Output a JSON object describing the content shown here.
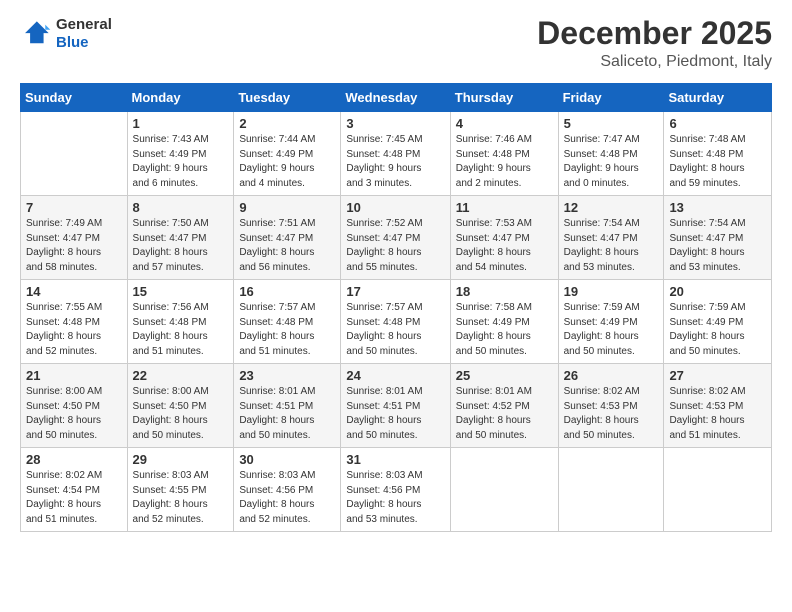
{
  "logo": {
    "line1": "General",
    "line2": "Blue"
  },
  "header": {
    "month": "December 2025",
    "location": "Saliceto, Piedmont, Italy"
  },
  "days_of_week": [
    "Sunday",
    "Monday",
    "Tuesday",
    "Wednesday",
    "Thursday",
    "Friday",
    "Saturday"
  ],
  "weeks": [
    [
      {
        "day": "",
        "info": ""
      },
      {
        "day": "1",
        "info": "Sunrise: 7:43 AM\nSunset: 4:49 PM\nDaylight: 9 hours\nand 6 minutes."
      },
      {
        "day": "2",
        "info": "Sunrise: 7:44 AM\nSunset: 4:49 PM\nDaylight: 9 hours\nand 4 minutes."
      },
      {
        "day": "3",
        "info": "Sunrise: 7:45 AM\nSunset: 4:48 PM\nDaylight: 9 hours\nand 3 minutes."
      },
      {
        "day": "4",
        "info": "Sunrise: 7:46 AM\nSunset: 4:48 PM\nDaylight: 9 hours\nand 2 minutes."
      },
      {
        "day": "5",
        "info": "Sunrise: 7:47 AM\nSunset: 4:48 PM\nDaylight: 9 hours\nand 0 minutes."
      },
      {
        "day": "6",
        "info": "Sunrise: 7:48 AM\nSunset: 4:48 PM\nDaylight: 8 hours\nand 59 minutes."
      }
    ],
    [
      {
        "day": "7",
        "info": "Sunrise: 7:49 AM\nSunset: 4:47 PM\nDaylight: 8 hours\nand 58 minutes."
      },
      {
        "day": "8",
        "info": "Sunrise: 7:50 AM\nSunset: 4:47 PM\nDaylight: 8 hours\nand 57 minutes."
      },
      {
        "day": "9",
        "info": "Sunrise: 7:51 AM\nSunset: 4:47 PM\nDaylight: 8 hours\nand 56 minutes."
      },
      {
        "day": "10",
        "info": "Sunrise: 7:52 AM\nSunset: 4:47 PM\nDaylight: 8 hours\nand 55 minutes."
      },
      {
        "day": "11",
        "info": "Sunrise: 7:53 AM\nSunset: 4:47 PM\nDaylight: 8 hours\nand 54 minutes."
      },
      {
        "day": "12",
        "info": "Sunrise: 7:54 AM\nSunset: 4:47 PM\nDaylight: 8 hours\nand 53 minutes."
      },
      {
        "day": "13",
        "info": "Sunrise: 7:54 AM\nSunset: 4:47 PM\nDaylight: 8 hours\nand 53 minutes."
      }
    ],
    [
      {
        "day": "14",
        "info": "Sunrise: 7:55 AM\nSunset: 4:48 PM\nDaylight: 8 hours\nand 52 minutes."
      },
      {
        "day": "15",
        "info": "Sunrise: 7:56 AM\nSunset: 4:48 PM\nDaylight: 8 hours\nand 51 minutes."
      },
      {
        "day": "16",
        "info": "Sunrise: 7:57 AM\nSunset: 4:48 PM\nDaylight: 8 hours\nand 51 minutes."
      },
      {
        "day": "17",
        "info": "Sunrise: 7:57 AM\nSunset: 4:48 PM\nDaylight: 8 hours\nand 50 minutes."
      },
      {
        "day": "18",
        "info": "Sunrise: 7:58 AM\nSunset: 4:49 PM\nDaylight: 8 hours\nand 50 minutes."
      },
      {
        "day": "19",
        "info": "Sunrise: 7:59 AM\nSunset: 4:49 PM\nDaylight: 8 hours\nand 50 minutes."
      },
      {
        "day": "20",
        "info": "Sunrise: 7:59 AM\nSunset: 4:49 PM\nDaylight: 8 hours\nand 50 minutes."
      }
    ],
    [
      {
        "day": "21",
        "info": "Sunrise: 8:00 AM\nSunset: 4:50 PM\nDaylight: 8 hours\nand 50 minutes."
      },
      {
        "day": "22",
        "info": "Sunrise: 8:00 AM\nSunset: 4:50 PM\nDaylight: 8 hours\nand 50 minutes."
      },
      {
        "day": "23",
        "info": "Sunrise: 8:01 AM\nSunset: 4:51 PM\nDaylight: 8 hours\nand 50 minutes."
      },
      {
        "day": "24",
        "info": "Sunrise: 8:01 AM\nSunset: 4:51 PM\nDaylight: 8 hours\nand 50 minutes."
      },
      {
        "day": "25",
        "info": "Sunrise: 8:01 AM\nSunset: 4:52 PM\nDaylight: 8 hours\nand 50 minutes."
      },
      {
        "day": "26",
        "info": "Sunrise: 8:02 AM\nSunset: 4:53 PM\nDaylight: 8 hours\nand 50 minutes."
      },
      {
        "day": "27",
        "info": "Sunrise: 8:02 AM\nSunset: 4:53 PM\nDaylight: 8 hours\nand 51 minutes."
      }
    ],
    [
      {
        "day": "28",
        "info": "Sunrise: 8:02 AM\nSunset: 4:54 PM\nDaylight: 8 hours\nand 51 minutes."
      },
      {
        "day": "29",
        "info": "Sunrise: 8:03 AM\nSunset: 4:55 PM\nDaylight: 8 hours\nand 52 minutes."
      },
      {
        "day": "30",
        "info": "Sunrise: 8:03 AM\nSunset: 4:56 PM\nDaylight: 8 hours\nand 52 minutes."
      },
      {
        "day": "31",
        "info": "Sunrise: 8:03 AM\nSunset: 4:56 PM\nDaylight: 8 hours\nand 53 minutes."
      },
      {
        "day": "",
        "info": ""
      },
      {
        "day": "",
        "info": ""
      },
      {
        "day": "",
        "info": ""
      }
    ]
  ]
}
